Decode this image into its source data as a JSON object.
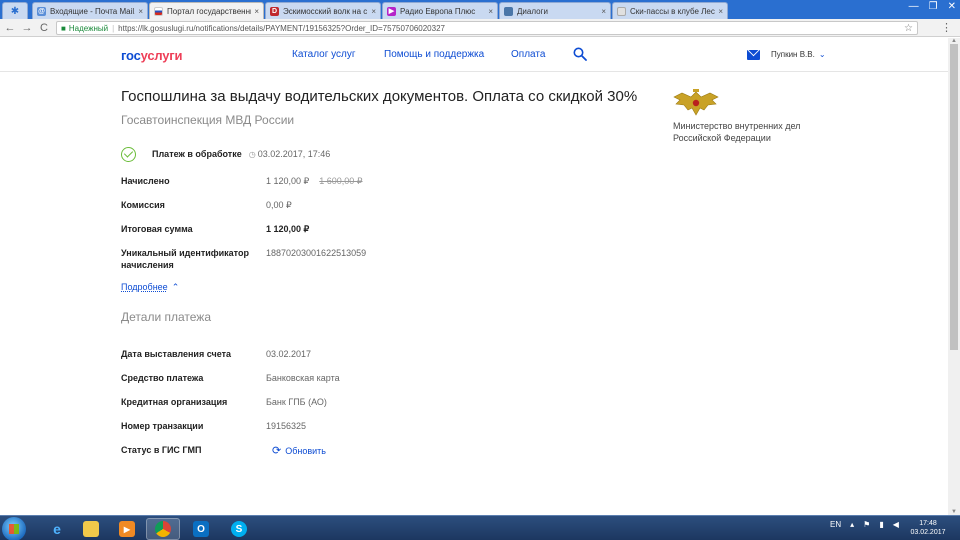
{
  "browser": {
    "tabs": [
      {
        "title": "Входящие - Почта Mail.Ru",
        "icon_color": "#5b8fd8",
        "icon": "mail-icon"
      },
      {
        "title": "Портал государственных услуг",
        "icon_color": "#ffffff",
        "icon": "ru-flag-icon"
      },
      {
        "title": "Эскимосский волк на с",
        "icon_color": "#c0282d",
        "icon": "d-logo-icon",
        "glyph": "D"
      },
      {
        "title": "Радио Европа Плюс",
        "icon_color": "#b524c9",
        "icon": "play-icon",
        "glyph": "▶"
      },
      {
        "title": "Диалоги",
        "icon_color": "#4a76a8",
        "icon": "vk-icon"
      },
      {
        "title": "Ски-пассы в клубе Лес",
        "icon_color": "#e0e0e0",
        "icon": "page-icon"
      }
    ],
    "close_glyph": "×",
    "window_controls": [
      "—",
      "❐",
      "✕"
    ],
    "secure_label": "Надежный",
    "url": "https://lk.gosuslugi.ru/notifications/details/PAYMENT/19156325?Order_ID=75750706020327"
  },
  "header": {
    "logo_part1": "гос",
    "logo_part2": "услуги",
    "nav": [
      "Каталог услуг",
      "Помощь и поддержка",
      "Оплата"
    ],
    "user_name": "Пупкин В.В."
  },
  "page": {
    "title": "Госпошлина за выдачу водительских документов. Оплата со скидкой 30%",
    "subtitle": "Госавтоинспекция МВД России",
    "status_label": "Платеж в обработке",
    "status_datetime": "03.02.2017, 17:46",
    "rows": [
      {
        "label": "Начислено",
        "value": "1 120,00 ₽",
        "old_value": "1 600,00 ₽"
      },
      {
        "label": "Комиссия",
        "value": "0,00 ₽"
      },
      {
        "label": "Итоговая сумма",
        "value": "1 120,00 ₽"
      },
      {
        "label": "Уникальный идентификатор",
        "label2": "начисления",
        "value": "18870203001622513059"
      }
    ],
    "more_link": "Подробнее",
    "details_title": "Детали платежа",
    "details": [
      {
        "label": "Дата выставления счета",
        "value": "03.02.2017"
      },
      {
        "label": "Средство платежа",
        "value": "Банковская карта"
      },
      {
        "label": "Кредитная организация",
        "value": "Банк ГПБ (АО)"
      },
      {
        "label": "Номер транзакции",
        "value": "19156325"
      },
      {
        "label": "Статус в ГИС ГМП",
        "value": "Обновить"
      }
    ]
  },
  "sidebar": {
    "ministry_line1": "Министерство внутренних дел",
    "ministry_line2": "Российской Федерации"
  },
  "taskbar": {
    "lang": "EN",
    "time": "17:48",
    "date": "03.02.2017"
  },
  "colors": {
    "accent": "#0d4cd3",
    "logo_red": "#ee3f58",
    "success": "#6bbd3a",
    "chrome_tabbar": "#2a6fd0"
  }
}
